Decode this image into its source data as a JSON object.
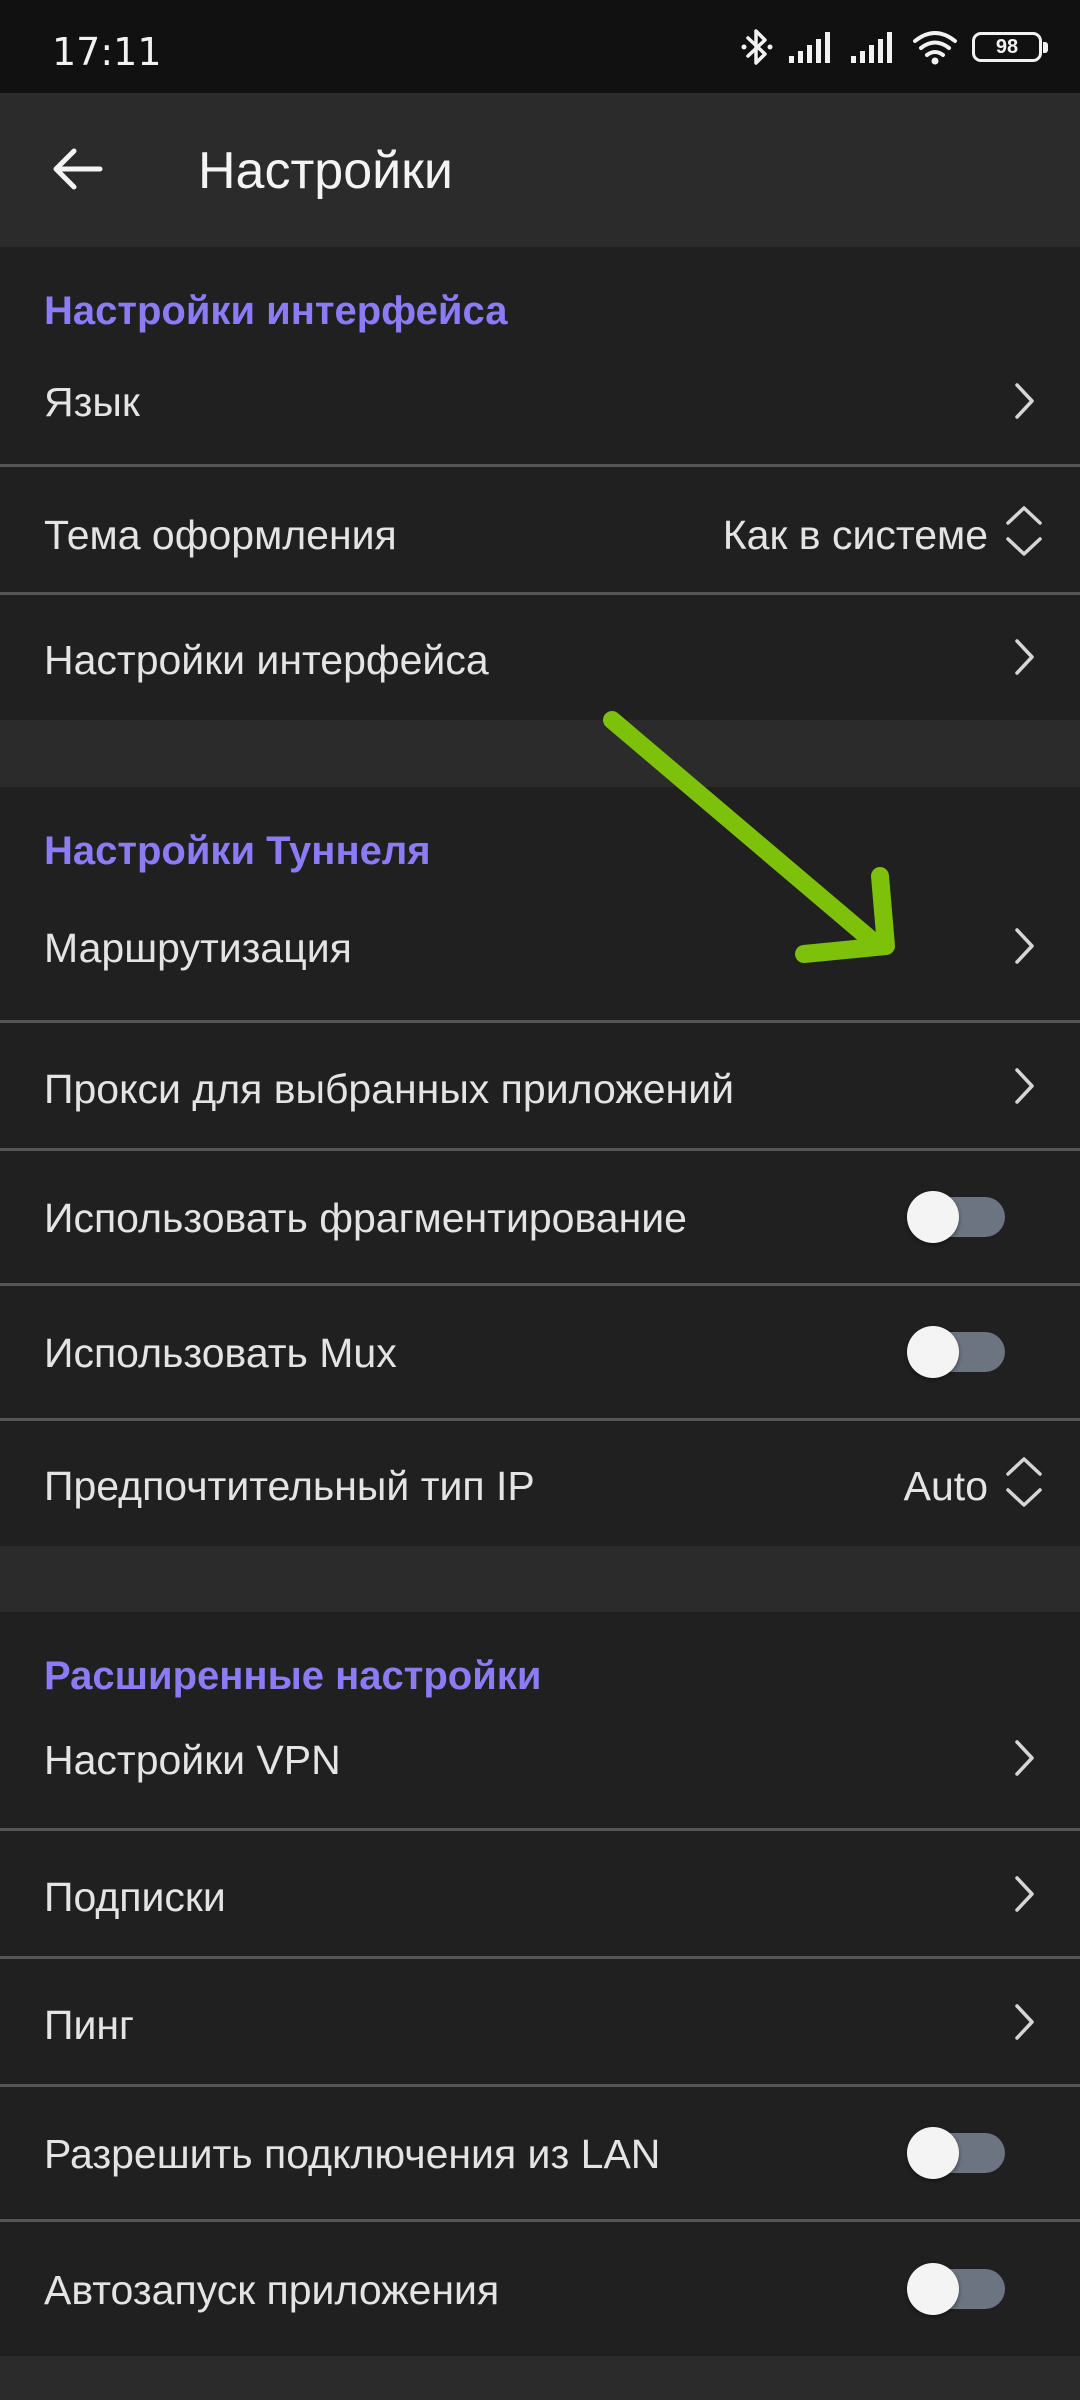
{
  "status_bar": {
    "time": "17:11",
    "battery": "98",
    "icons": [
      "bluetooth-icon",
      "signal-icon",
      "signal-icon",
      "wifi-icon",
      "battery-icon"
    ]
  },
  "app_bar": {
    "title": "Настройки",
    "back_icon": "arrow-left-icon"
  },
  "sections": {
    "interface": {
      "title": "Настройки интерфейса",
      "items": [
        {
          "label": "Язык",
          "type": "link"
        },
        {
          "label": "Тема оформления",
          "type": "select",
          "value": "Как в системе"
        },
        {
          "label": "Настройки интерфейса",
          "type": "link"
        }
      ]
    },
    "tunnel": {
      "title": "Настройки Туннеля",
      "items": [
        {
          "label": "Маршрутизация",
          "type": "link"
        },
        {
          "label": "Прокси для выбранных приложений",
          "type": "link"
        },
        {
          "label": "Использовать фрагментирование",
          "type": "toggle",
          "on": false
        },
        {
          "label": "Использовать Mux",
          "type": "toggle",
          "on": false
        },
        {
          "label": "Предпочтительный тип IP",
          "type": "select",
          "value": "Auto"
        }
      ]
    },
    "advanced": {
      "title": "Расширенные настройки",
      "items": [
        {
          "label": "Настройки VPN",
          "type": "link"
        },
        {
          "label": "Подписки",
          "type": "link"
        },
        {
          "label": "Пинг",
          "type": "link"
        },
        {
          "label": "Разрешить подключения из LAN",
          "type": "toggle",
          "on": false
        },
        {
          "label": "Автозапуск приложения",
          "type": "toggle",
          "on": false
        }
      ]
    }
  },
  "colors": {
    "accent": "#8b7cf6",
    "background": "#202020",
    "gap": "#2b2b2b",
    "annotation_arrow": "#7dc10a"
  },
  "annotation": {
    "icon": "green-arrow-icon"
  }
}
